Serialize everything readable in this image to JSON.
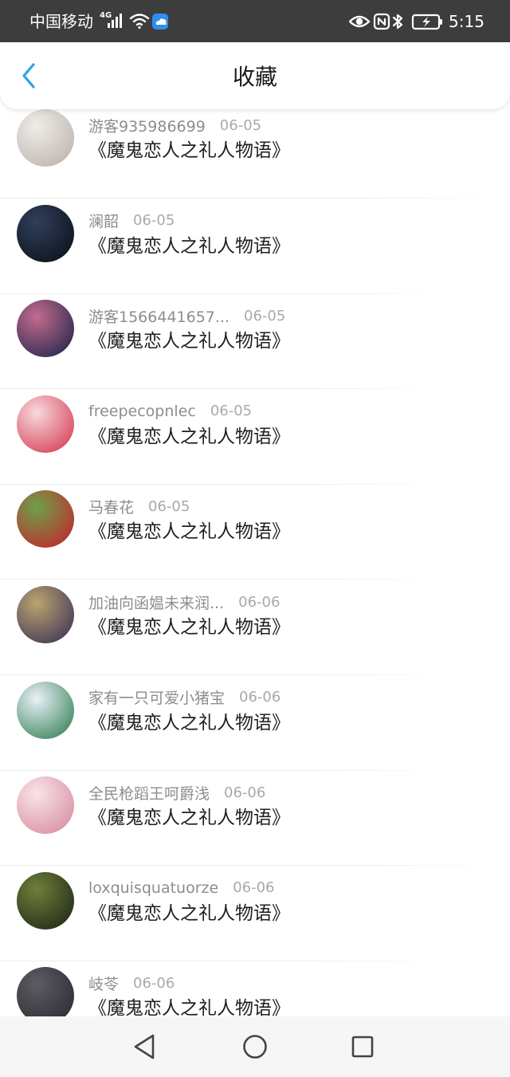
{
  "status_bar": {
    "carrier": "中国移动",
    "network": "4G",
    "time": "5:15"
  },
  "header": {
    "title": "收藏"
  },
  "colors": {
    "accent": "#2aa4e6",
    "status_bar_bg": "#3d3d3d"
  },
  "items": [
    {
      "user": "游客935986699",
      "date": "06-05",
      "title": "《魔鬼恋人之礼人物语》",
      "avatar_colors": [
        "#f0ece8",
        "#b9b1ab"
      ]
    },
    {
      "user": "澜韶",
      "date": "06-05",
      "title": "《魔鬼恋人之礼人物语》",
      "avatar_colors": [
        "#2f3f5a",
        "#0c0f17"
      ]
    },
    {
      "user": "游客1566441657...",
      "date": "06-05",
      "title": "《魔鬼恋人之礼人物语》",
      "avatar_colors": [
        "#c46b8e",
        "#1b2448"
      ]
    },
    {
      "user": "freepecopnlec",
      "date": "06-05",
      "title": "《魔鬼恋人之礼人物语》",
      "avatar_colors": [
        "#f7d9de",
        "#d4374f"
      ]
    },
    {
      "user": "马春花",
      "date": "06-05",
      "title": "《魔鬼恋人之礼人物语》",
      "avatar_colors": [
        "#6fa04a",
        "#c4222a"
      ]
    },
    {
      "user": "加油向函媪未来润...",
      "date": "06-06",
      "title": "《魔鬼恋人之礼人物语》",
      "avatar_colors": [
        "#b9a46f",
        "#3a2f55"
      ]
    },
    {
      "user": "家有一只可爱小猪宝",
      "date": "06-06",
      "title": "《魔鬼恋人之礼人物语》",
      "avatar_colors": [
        "#e9f1f8",
        "#2e7c4f"
      ]
    },
    {
      "user": "全民枪蹈王呵爵浅",
      "date": "06-06",
      "title": "《魔鬼恋人之礼人物语》",
      "avatar_colors": [
        "#f8e3e8",
        "#d88a9e"
      ]
    },
    {
      "user": "loxquisquatuorze",
      "date": "06-06",
      "title": "《魔鬼恋人之礼人物语》",
      "avatar_colors": [
        "#6f7f3a",
        "#1c2414"
      ]
    },
    {
      "user": "岐苓",
      "date": "06-06",
      "title": "《魔鬼恋人之礼人物语》",
      "avatar_colors": [
        "#5d5b63",
        "#2a2a2f"
      ]
    }
  ]
}
